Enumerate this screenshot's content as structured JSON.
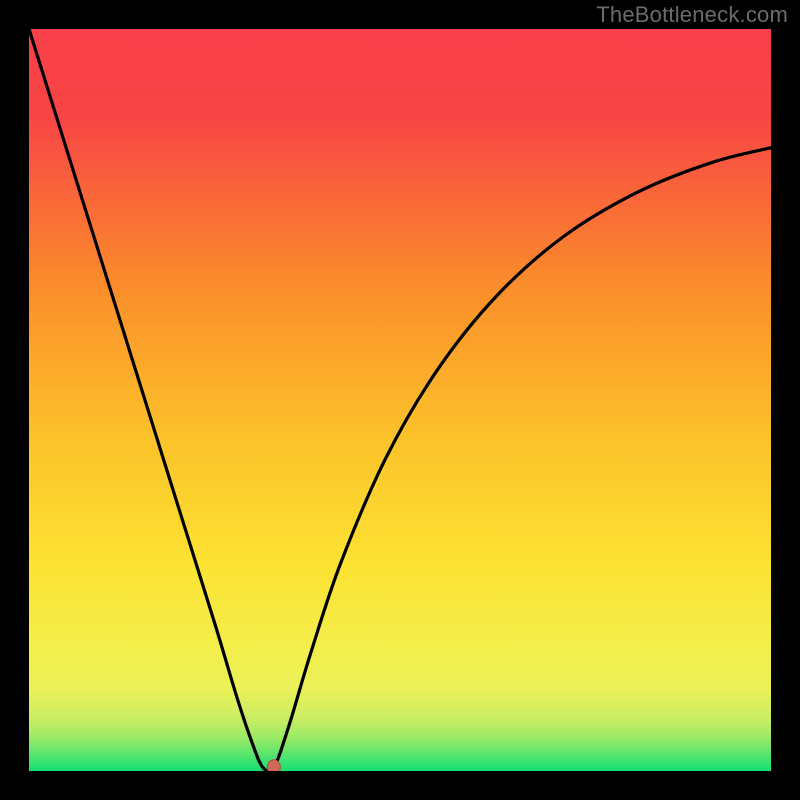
{
  "watermark": "TheBottleneck.com",
  "colors": {
    "frame": "#000000",
    "curve": "#000000",
    "marker_fill": "#cf6a56",
    "marker_stroke": "#b24d3d",
    "green": "#14e072",
    "yellowgreen": "#d7ef60",
    "yellow": "#fde232",
    "orange": "#fb8e2b",
    "red": "#f83f4a"
  },
  "chart_data": {
    "type": "line",
    "title": "",
    "xlabel": "",
    "ylabel": "",
    "xlim": [
      0,
      100
    ],
    "ylim": [
      0,
      100
    ],
    "series": [
      {
        "name": "bottleneck-curve",
        "x": [
          0,
          5,
          10,
          15,
          20,
          25,
          28,
          30,
          31.5,
          33,
          35,
          38,
          42,
          48,
          55,
          63,
          72,
          82,
          92,
          100
        ],
        "values": [
          100,
          84,
          68,
          52,
          36,
          20,
          10,
          4,
          0.5,
          0.5,
          6,
          16,
          28,
          42,
          54,
          64,
          72,
          78,
          82,
          84
        ]
      }
    ],
    "marker": {
      "x": 33,
      "y": 0.5
    },
    "background_bands": [
      {
        "from_y": 0,
        "to_y": 2,
        "color": "#14e072"
      },
      {
        "from_y": 2,
        "to_y": 6,
        "color": "#7be86a"
      },
      {
        "from_y": 6,
        "to_y": 12,
        "color": "#d7ef60"
      },
      {
        "from_y": 12,
        "to_y": 18,
        "color": "#f3ee4a"
      },
      {
        "from_y": 18,
        "to_y": 60,
        "color_gradient": [
          "#fde232",
          "#fb8e2b"
        ]
      },
      {
        "from_y": 60,
        "to_y": 100,
        "color_gradient": [
          "#fb8e2b",
          "#f83f4a"
        ]
      }
    ]
  }
}
